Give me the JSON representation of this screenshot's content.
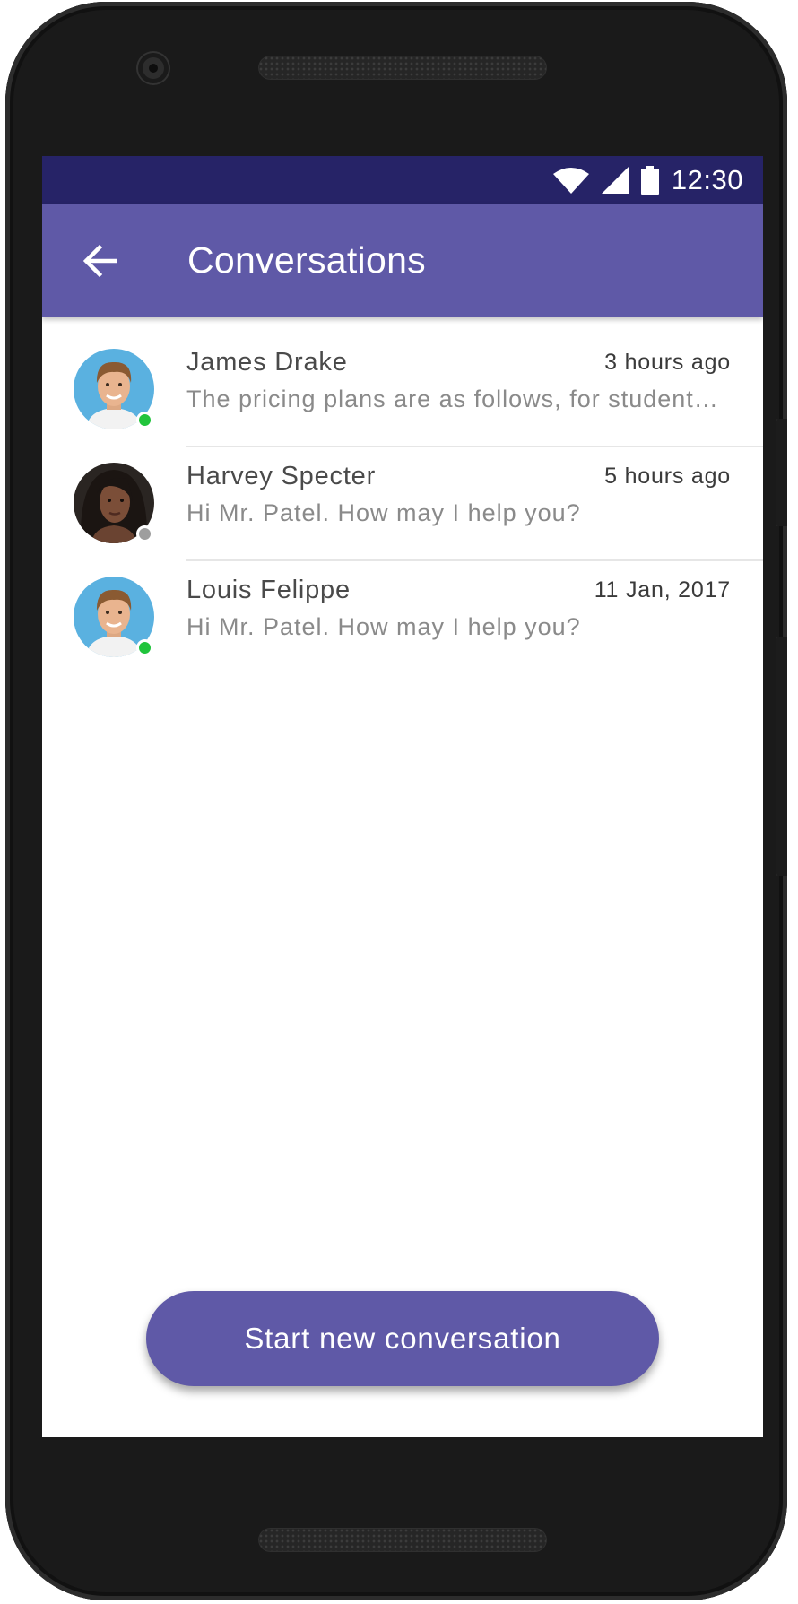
{
  "status_bar": {
    "time": "12:30",
    "icons": [
      "wifi-icon",
      "cellular-signal-icon",
      "battery-icon"
    ],
    "color": "#262367"
  },
  "app_bar": {
    "title": "Conversations",
    "back_icon": "arrow-left-icon",
    "color": "#5f59a7"
  },
  "conversations": [
    {
      "name": "James Drake",
      "time": "3 hours ago",
      "preview": "The pricing plans are as follows, for students...",
      "status": "online",
      "avatar": "man-avatar"
    },
    {
      "name": "Harvey Specter",
      "time": "5 hours ago",
      "preview": "Hi Mr. Patel. How may I help you?",
      "status": "offline",
      "avatar": "woman-avatar"
    },
    {
      "name": "Louis Felippe",
      "time": "11 Jan, 2017",
      "preview": "Hi Mr. Patel. How may I help you?",
      "status": "online",
      "avatar": "man-avatar"
    }
  ],
  "colors": {
    "online": "#21c43c",
    "offline": "#9e9e9e",
    "accent": "#5f59a7"
  },
  "new_conversation_label": "Start new conversation"
}
